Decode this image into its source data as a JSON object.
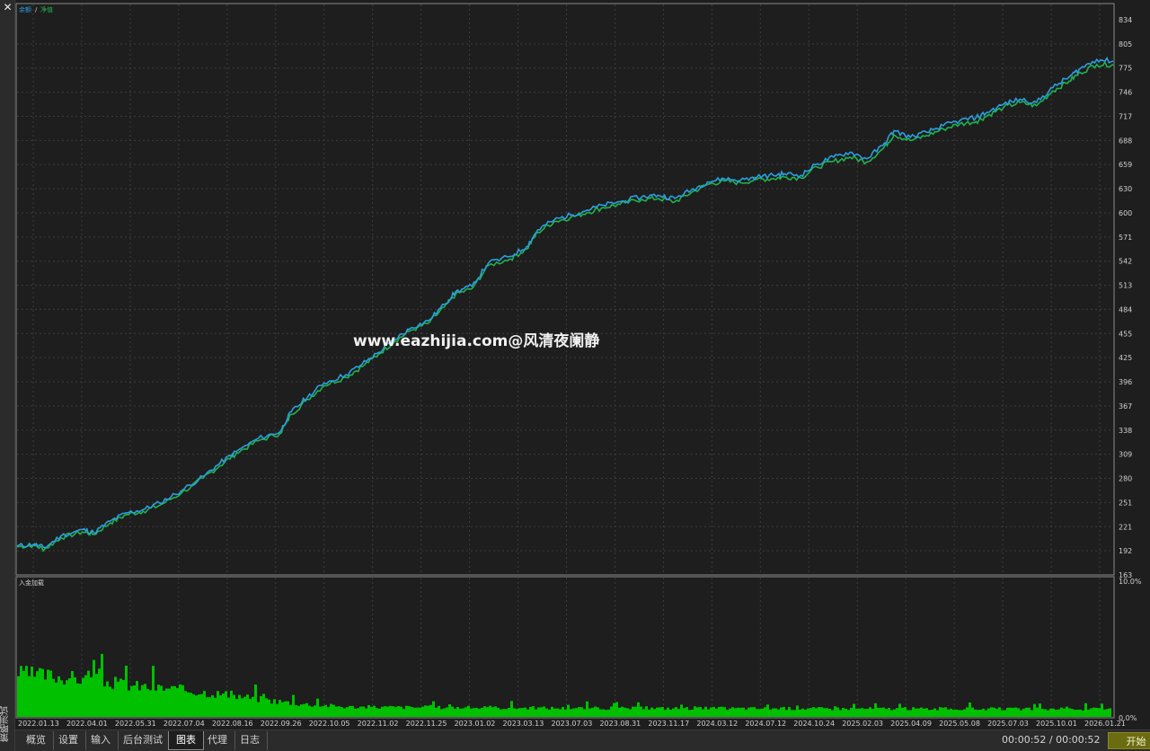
{
  "window": {
    "close_glyph": "✕",
    "vertical_title": "策略测试"
  },
  "watermark": "www.eazhijia.com@风清夜阑静",
  "tabs": [
    "概览",
    "设置",
    "输入",
    "后台测试",
    "图表",
    "代理",
    "日志"
  ],
  "active_tab": "图表",
  "status": {
    "elapsed": "00:00:52 / 00:00:52",
    "start_label": "开始"
  },
  "colors": {
    "background": "#1e1e1e",
    "grid": "#3c3c3c",
    "balance": "#2a9fe0",
    "equity": "#22b14c",
    "load_bars": "#00c000",
    "start_button": "#6b6b10"
  },
  "chart_data": [
    {
      "type": "line",
      "legend": {
        "balance": "余额",
        "separator": "/",
        "equity": "净值"
      },
      "y_ticks": [
        "834",
        "805",
        "775",
        "746",
        "717",
        "688",
        "659",
        "630",
        "600",
        "571",
        "542",
        "513",
        "484",
        "455",
        "425",
        "396",
        "367",
        "338",
        "309",
        "280",
        "251",
        "221",
        "192",
        "163"
      ],
      "ylim": [
        163,
        834
      ],
      "x_ticks": [
        "2022.01.13",
        "2022.04.01",
        "2022.05.31",
        "2022.07.04",
        "2022.08.16",
        "2022.09.26",
        "2022.10.05",
        "2022.11.02",
        "2022.11.25",
        "2023.01.02",
        "2023.03.13",
        "2023.07.03",
        "2023.08.31",
        "2023.11.17",
        "2024.03.12",
        "2024.07.12",
        "2024.10.24",
        "2025.02.03",
        "2025.04.09",
        "2025.05.08",
        "2025.07.03",
        "2025.10.01",
        "2026.01.21"
      ],
      "grid": true,
      "series": [
        {
          "name": "余额",
          "x": [
            0,
            0.015,
            0.025,
            0.04,
            0.06,
            0.07,
            0.085,
            0.1,
            0.115,
            0.13,
            0.15,
            0.17,
            0.185,
            0.2,
            0.22,
            0.24,
            0.25,
            0.265,
            0.28,
            0.3,
            0.315,
            0.33,
            0.345,
            0.36,
            0.375,
            0.39,
            0.4,
            0.415,
            0.43,
            0.45,
            0.465,
            0.475,
            0.49,
            0.505,
            0.52,
            0.535,
            0.55,
            0.57,
            0.585,
            0.6,
            0.615,
            0.63,
            0.645,
            0.66,
            0.675,
            0.69,
            0.7,
            0.715,
            0.73,
            0.745,
            0.76,
            0.775,
            0.79,
            0.8,
            0.815,
            0.83,
            0.845,
            0.86,
            0.875,
            0.885,
            0.9,
            0.915,
            0.93,
            0.945,
            0.96,
            0.97,
            0.985,
            1
          ],
          "values": [
            198,
            200,
            196,
            210,
            218,
            214,
            228,
            238,
            242,
            250,
            265,
            282,
            298,
            312,
            328,
            336,
            360,
            378,
            395,
            405,
            418,
            432,
            448,
            462,
            470,
            490,
            505,
            512,
            540,
            548,
            560,
            580,
            592,
            598,
            604,
            610,
            614,
            620,
            622,
            618,
            628,
            638,
            642,
            640,
            644,
            646,
            648,
            646,
            660,
            668,
            674,
            666,
            682,
            700,
            692,
            698,
            706,
            712,
            716,
            722,
            732,
            738,
            734,
            752,
            765,
            775,
            786,
            784
          ]
        },
        {
          "name": "净值",
          "x": [
            0,
            0.015,
            0.025,
            0.04,
            0.06,
            0.07,
            0.085,
            0.1,
            0.115,
            0.13,
            0.15,
            0.17,
            0.185,
            0.2,
            0.22,
            0.24,
            0.25,
            0.265,
            0.28,
            0.3,
            0.315,
            0.33,
            0.345,
            0.36,
            0.375,
            0.39,
            0.4,
            0.415,
            0.43,
            0.45,
            0.465,
            0.475,
            0.49,
            0.505,
            0.52,
            0.535,
            0.55,
            0.57,
            0.585,
            0.6,
            0.615,
            0.63,
            0.645,
            0.66,
            0.675,
            0.69,
            0.7,
            0.715,
            0.73,
            0.745,
            0.76,
            0.775,
            0.79,
            0.8,
            0.815,
            0.83,
            0.845,
            0.86,
            0.875,
            0.885,
            0.9,
            0.915,
            0.93,
            0.945,
            0.96,
            0.97,
            0.985,
            1
          ],
          "values": [
            197,
            199,
            194,
            208,
            215,
            212,
            226,
            236,
            240,
            247,
            262,
            280,
            295,
            310,
            325,
            334,
            357,
            375,
            392,
            402,
            415,
            430,
            446,
            459,
            467,
            487,
            502,
            509,
            537,
            545,
            557,
            577,
            590,
            595,
            601,
            607,
            611,
            617,
            618,
            614,
            625,
            635,
            639,
            637,
            641,
            642,
            644,
            643,
            656,
            663,
            668,
            662,
            678,
            695,
            688,
            694,
            702,
            708,
            711,
            718,
            728,
            734,
            730,
            748,
            760,
            770,
            780,
            780
          ]
        }
      ]
    },
    {
      "type": "bar",
      "title": "入金加载",
      "y_ticks": [
        "10.0%",
        "0.0%"
      ],
      "ylim": [
        0,
        10
      ],
      "envelope": {
        "x": [
          0,
          0.03,
          0.07,
          0.11,
          0.15,
          0.19,
          0.23,
          0.26,
          0.3,
          0.5,
          0.8,
          1
        ],
        "values": [
          3.7,
          3.5,
          3.1,
          2.6,
          2.3,
          1.9,
          1.4,
          1.1,
          0.85,
          0.75,
          0.7,
          0.65
        ]
      }
    }
  ]
}
